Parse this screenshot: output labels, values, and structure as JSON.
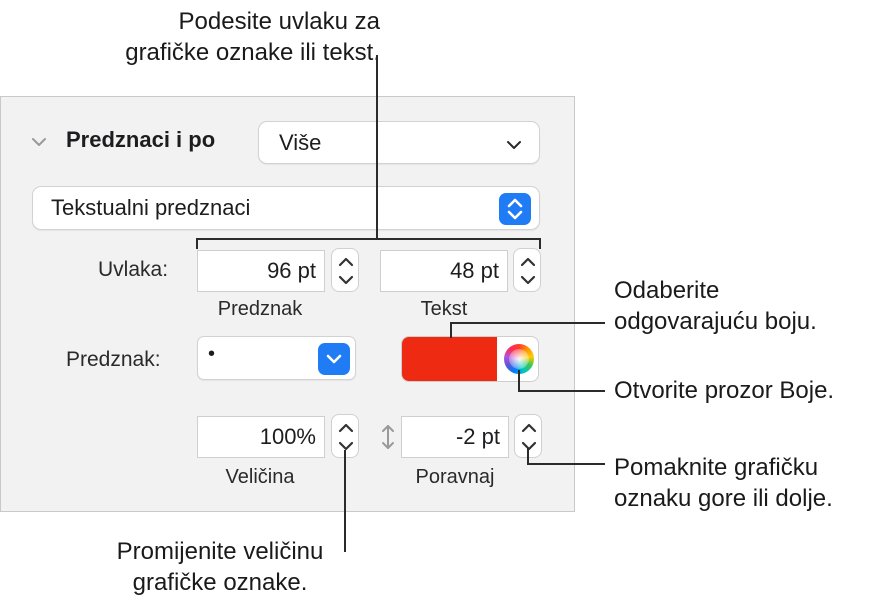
{
  "callouts": {
    "indent": [
      "Podesite uvlaku za",
      "grafičke oznake ili tekst."
    ],
    "color": [
      "Odaberite",
      "odgovarajuću boju."
    ],
    "colors_window": "Otvorite prozor Boje.",
    "align": [
      "Pomaknite grafičku",
      "oznaku gore ili dolje."
    ],
    "size": [
      "Promijenite veličinu",
      "grafičke oznake."
    ]
  },
  "section": {
    "title": "Predznaci i po",
    "list_style": "Više",
    "bullet_type": "Tekstualni predznaci"
  },
  "indent": {
    "label": "Uvlaka:",
    "bullet_value": "96 pt",
    "bullet_sublabel": "Predznak",
    "text_value": "48 pt",
    "text_sublabel": "Tekst"
  },
  "bullet": {
    "label": "Predznak:",
    "value": "•",
    "color": "#ee2a12"
  },
  "size": {
    "value": "100%",
    "sublabel": "Veličina"
  },
  "align": {
    "value": "-2 pt",
    "sublabel": "Poravnaj"
  },
  "icons": {
    "chevron": "chevron-down-icon",
    "stepper": "stepper-arrows-icon",
    "vertical_arrows": "vertical-arrows-icon",
    "color_wheel": "color-wheel-icon"
  }
}
